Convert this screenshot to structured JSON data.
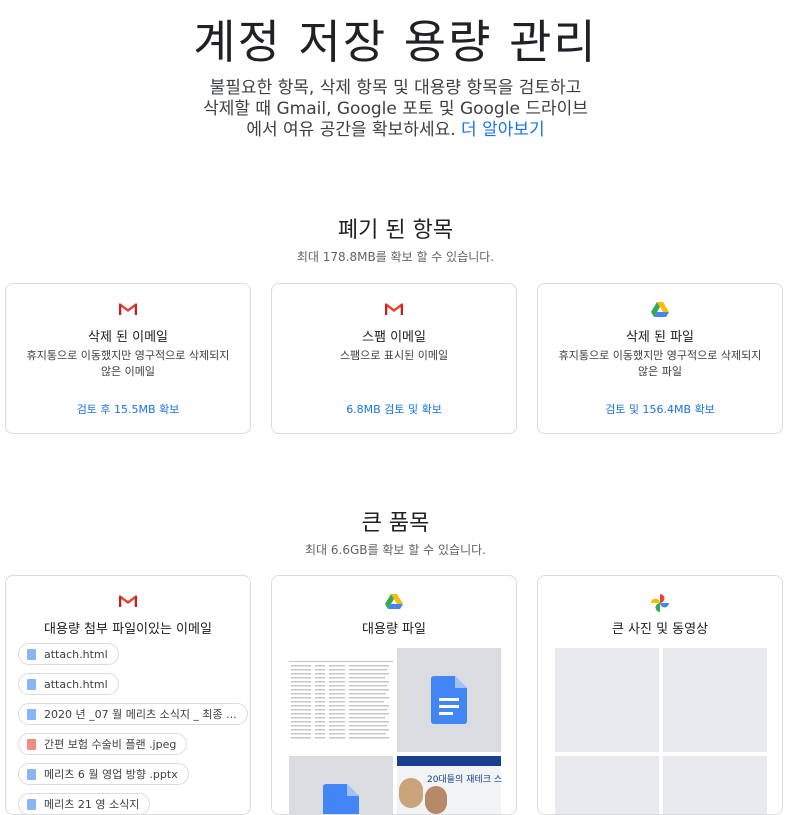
{
  "header": {
    "title": "계정 저장 용량 관리",
    "intro_line1": "불필요한 항목, 삭제 항목 및 대용량 항목을 검토하고",
    "intro_line2": "삭제할 때 Gmail, Google 포토 및 Google 드라이브",
    "intro_line3": "에서 여유 공간을 확보하세요.",
    "learn_more": "더 알아보기"
  },
  "discarded": {
    "title": "폐기 된 항목",
    "subtitle": "최대 178.8MB를 확보 할 수 있습니다.",
    "cards": [
      {
        "icon": "gmail-icon",
        "title": "삭제 된 이메일",
        "desc": "휴지통으로 이동했지만 영구적으로 삭제되지 않은 이메일",
        "action": "검토 후 15.5MB 확보"
      },
      {
        "icon": "gmail-icon",
        "title": "스팸 이메일",
        "desc": "스팸으로 표시된 이메일",
        "action": "6.8MB 검토 및 확보"
      },
      {
        "icon": "drive-icon",
        "title": "삭제 된 파일",
        "desc": "휴지통으로 이동했지만 영구적으로 삭제되지 않은 파일",
        "action": "검토 및 156.4MB 확보"
      }
    ]
  },
  "large": {
    "title": "큰 품목",
    "subtitle": "최대 6.6GB를 확보 할 수 있습니다.",
    "cards": [
      {
        "icon": "gmail-icon",
        "title": "대용량 첨부 파일이있는 이메일"
      },
      {
        "icon": "drive-icon",
        "title": "대용량 파일"
      },
      {
        "icon": "photos-icon",
        "title": "큰 사진 및 동영상"
      }
    ],
    "attachments": [
      {
        "name": "attach.html",
        "color": "#8ab4f8"
      },
      {
        "name": "attach.html",
        "color": "#8ab4f8"
      },
      {
        "name": "2020 년 _07 월 메리츠 소식지 _ 최종 ...",
        "color": "#8ab4f8"
      },
      {
        "name": "간편 보험 수술비 플랜 .jpeg",
        "color": "#f28b82"
      },
      {
        "name": "메리츠 6 월 영업 방향 .pptx",
        "color": "#8ab4f8"
      },
      {
        "name": "메리츠 21 영 소식지",
        "color": "#8ab4f8"
      }
    ],
    "thumb_text": "20대들의 재테크 스"
  }
}
